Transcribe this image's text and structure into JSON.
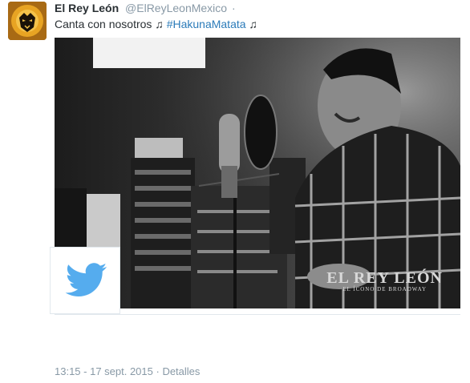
{
  "tweet": {
    "author_name": "El Rey León",
    "author_handle": "@ElReyLeonMexico",
    "separator": "·",
    "text": "Canta con nosotros ♫ ",
    "hashtag": "#HakunaMatata",
    "text_end": " ♫",
    "timestamp": "13:15 - 17 sept. 2015",
    "timestamp_sep": " · ",
    "details_link": "Detalles"
  },
  "media": {
    "watermark_title": "EL REY LEÓN",
    "watermark_subtitle": "EL ÍCONO DE BROADWAY",
    "description_icon": "twitter-bird-icon"
  },
  "colors": {
    "link": "#2b7bb9",
    "muted": "#8899a6",
    "text": "#292f33",
    "twitter_blue": "#55acee"
  }
}
